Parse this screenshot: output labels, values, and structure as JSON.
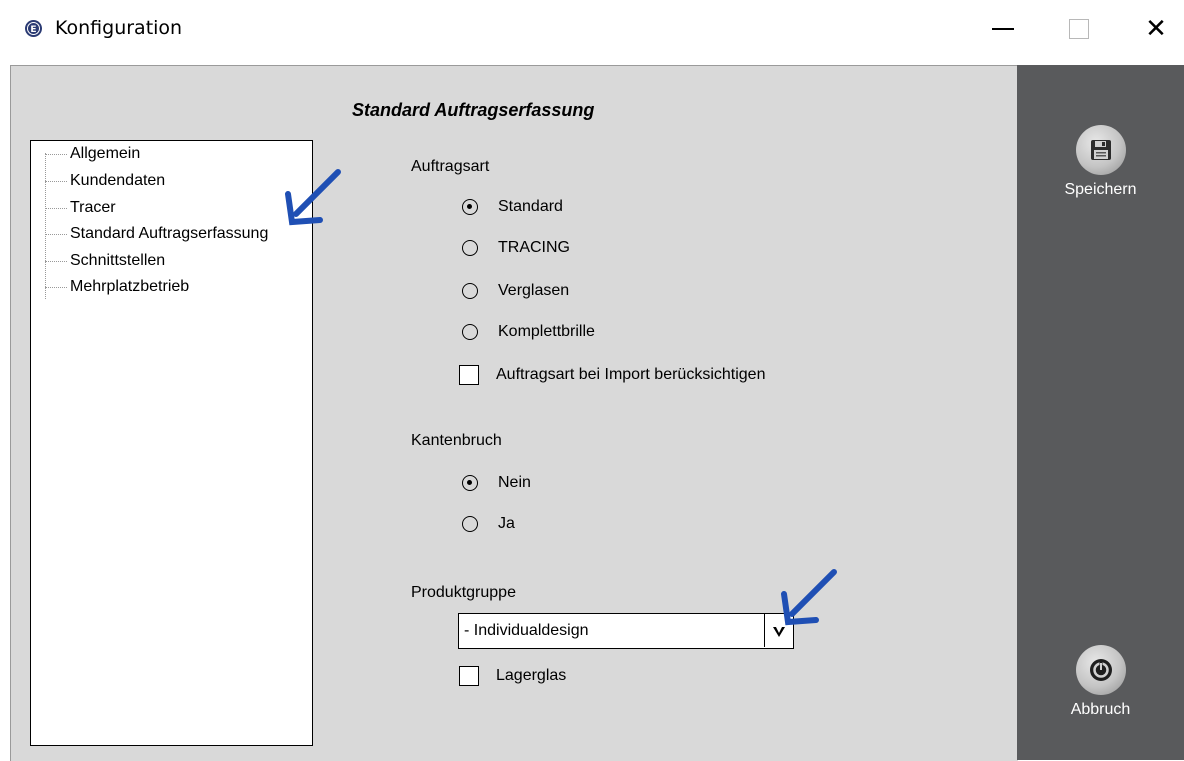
{
  "window": {
    "title": "Konfiguration",
    "app_icon": "E",
    "controls": [
      "minimize-icon",
      "maximize-icon",
      "close-icon"
    ]
  },
  "tree": {
    "items": [
      {
        "label": "Allgemein"
      },
      {
        "label": "Kundendaten"
      },
      {
        "label": "Tracer"
      },
      {
        "label": "Standard Auftragserfassung"
      },
      {
        "label": "Schnittstellen"
      },
      {
        "label": "Mehrplatzbetrieb"
      }
    ]
  },
  "main": {
    "section_title": "Standard Auftragserfassung",
    "auftragsart": {
      "label": "Auftragsart",
      "options": [
        {
          "label": "Standard",
          "checked": true
        },
        {
          "label": "TRACING",
          "checked": false
        },
        {
          "label": "Verglasen",
          "checked": false
        },
        {
          "label": "Komplettbrille",
          "checked": false
        }
      ],
      "import_checkbox": {
        "label": "Auftragsart bei Import berücksichtigen",
        "checked": false
      }
    },
    "kantenbruch": {
      "label": "Kantenbruch",
      "options": [
        {
          "label": "Nein",
          "checked": true
        },
        {
          "label": "Ja",
          "checked": false
        }
      ]
    },
    "produktgruppe": {
      "label": "Produktgruppe",
      "selected": "- Individualdesign",
      "arrow": "⮟"
    },
    "lagerglas": {
      "label": "Lagerglas",
      "checked": false
    }
  },
  "actions": {
    "save": {
      "label": "Speichern",
      "icon": "floppy-disk-icon"
    },
    "cancel": {
      "label": "Abbruch",
      "icon": "power-icon"
    }
  },
  "colors": {
    "content_bg": "#d9d9d9",
    "side_panel_bg": "#595a5c",
    "annotation_arrow": "#1f4fb4"
  }
}
